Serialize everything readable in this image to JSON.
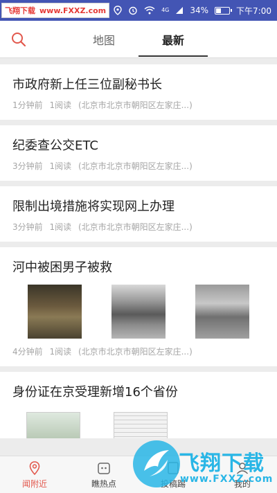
{
  "status_bar": {
    "watermark_left": "飞翔下载",
    "watermark_url": "www.FXXZ.com",
    "signal_text": "4G",
    "battery_text": "34%",
    "battery_level": 0.34,
    "time": "下午7:00"
  },
  "tabs": {
    "map": "地图",
    "latest": "最新"
  },
  "feed": [
    {
      "title": "市政府新上任三位副秘书长",
      "time": "1分钟前",
      "reads": "1阅读",
      "location": "(北京市北京市朝阳区左家庄...)"
    },
    {
      "title": "纪委查公交ETC",
      "time": "3分钟前",
      "reads": "1阅读",
      "location": "(北京市北京市朝阳区左家庄...)"
    },
    {
      "title": "限制出境措施将实现网上办理",
      "time": "3分钟前",
      "reads": "1阅读",
      "location": "(北京市北京市朝阳区左家庄...)"
    },
    {
      "title": "河中被困男子被救",
      "time": "4分钟前",
      "reads": "1阅读",
      "location": "(北京市北京市朝阳区左家庄...)"
    },
    {
      "title": "身份证在京受理新增16个省份"
    }
  ],
  "bottom_nav": {
    "nearby": "闻附近",
    "hot": "瞧热点",
    "report": "投稿踢",
    "mine": "我的"
  },
  "overlay_watermark": {
    "cn": "飞翔下载",
    "en": "www.FXXZ.com"
  },
  "colors": {
    "status_bar": "#4355b4",
    "accent": "#e2574c",
    "watermark_blue": "#29b6e6"
  }
}
